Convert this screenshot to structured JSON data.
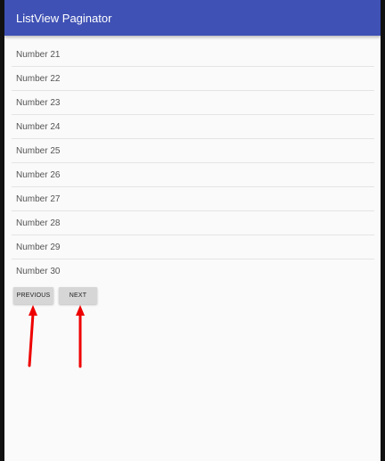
{
  "app_bar": {
    "title": "ListView Paginator",
    "color": "#3f51b5"
  },
  "list": {
    "items": [
      {
        "label": "Number 21"
      },
      {
        "label": "Number 22"
      },
      {
        "label": "Number 23"
      },
      {
        "label": "Number 24"
      },
      {
        "label": "Number 25"
      },
      {
        "label": "Number 26"
      },
      {
        "label": "Number 27"
      },
      {
        "label": "Number 28"
      },
      {
        "label": "Number 29"
      },
      {
        "label": "Number 30"
      }
    ]
  },
  "pagination": {
    "previous_label": "PREVIOUS",
    "next_label": "NEXT"
  },
  "annotations": {
    "arrow_color": "#ee0000"
  }
}
